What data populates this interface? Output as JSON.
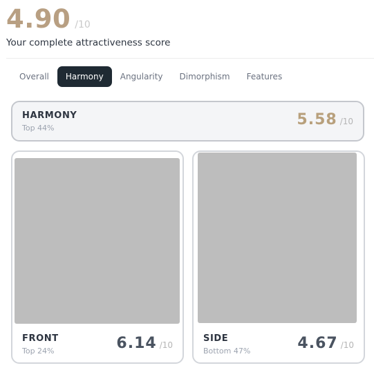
{
  "overall": {
    "score": "4.90",
    "denominator": "/10",
    "subtitle": "Your complete attractiveness score"
  },
  "tabs": [
    {
      "label": "Overall",
      "active": false
    },
    {
      "label": "Harmony",
      "active": true
    },
    {
      "label": "Angularity",
      "active": false
    },
    {
      "label": "Dimorphism",
      "active": false
    },
    {
      "label": "Features",
      "active": false
    }
  ],
  "summary": {
    "title": "HARMONY",
    "rank": "Top 44%",
    "score": "5.58",
    "denominator": "/10"
  },
  "cards": [
    {
      "title": "FRONT",
      "rank": "Top 24%",
      "score": "6.14",
      "denominator": "/10"
    },
    {
      "title": "SIDE",
      "rank": "Bottom 47%",
      "score": "4.67",
      "denominator": "/10"
    }
  ],
  "colors": {
    "accent_gold": "#b89f82",
    "summary_score_gold": "#b8a07c",
    "dark_score": "#4a5360",
    "tab_active_bg": "#1f2a33"
  }
}
